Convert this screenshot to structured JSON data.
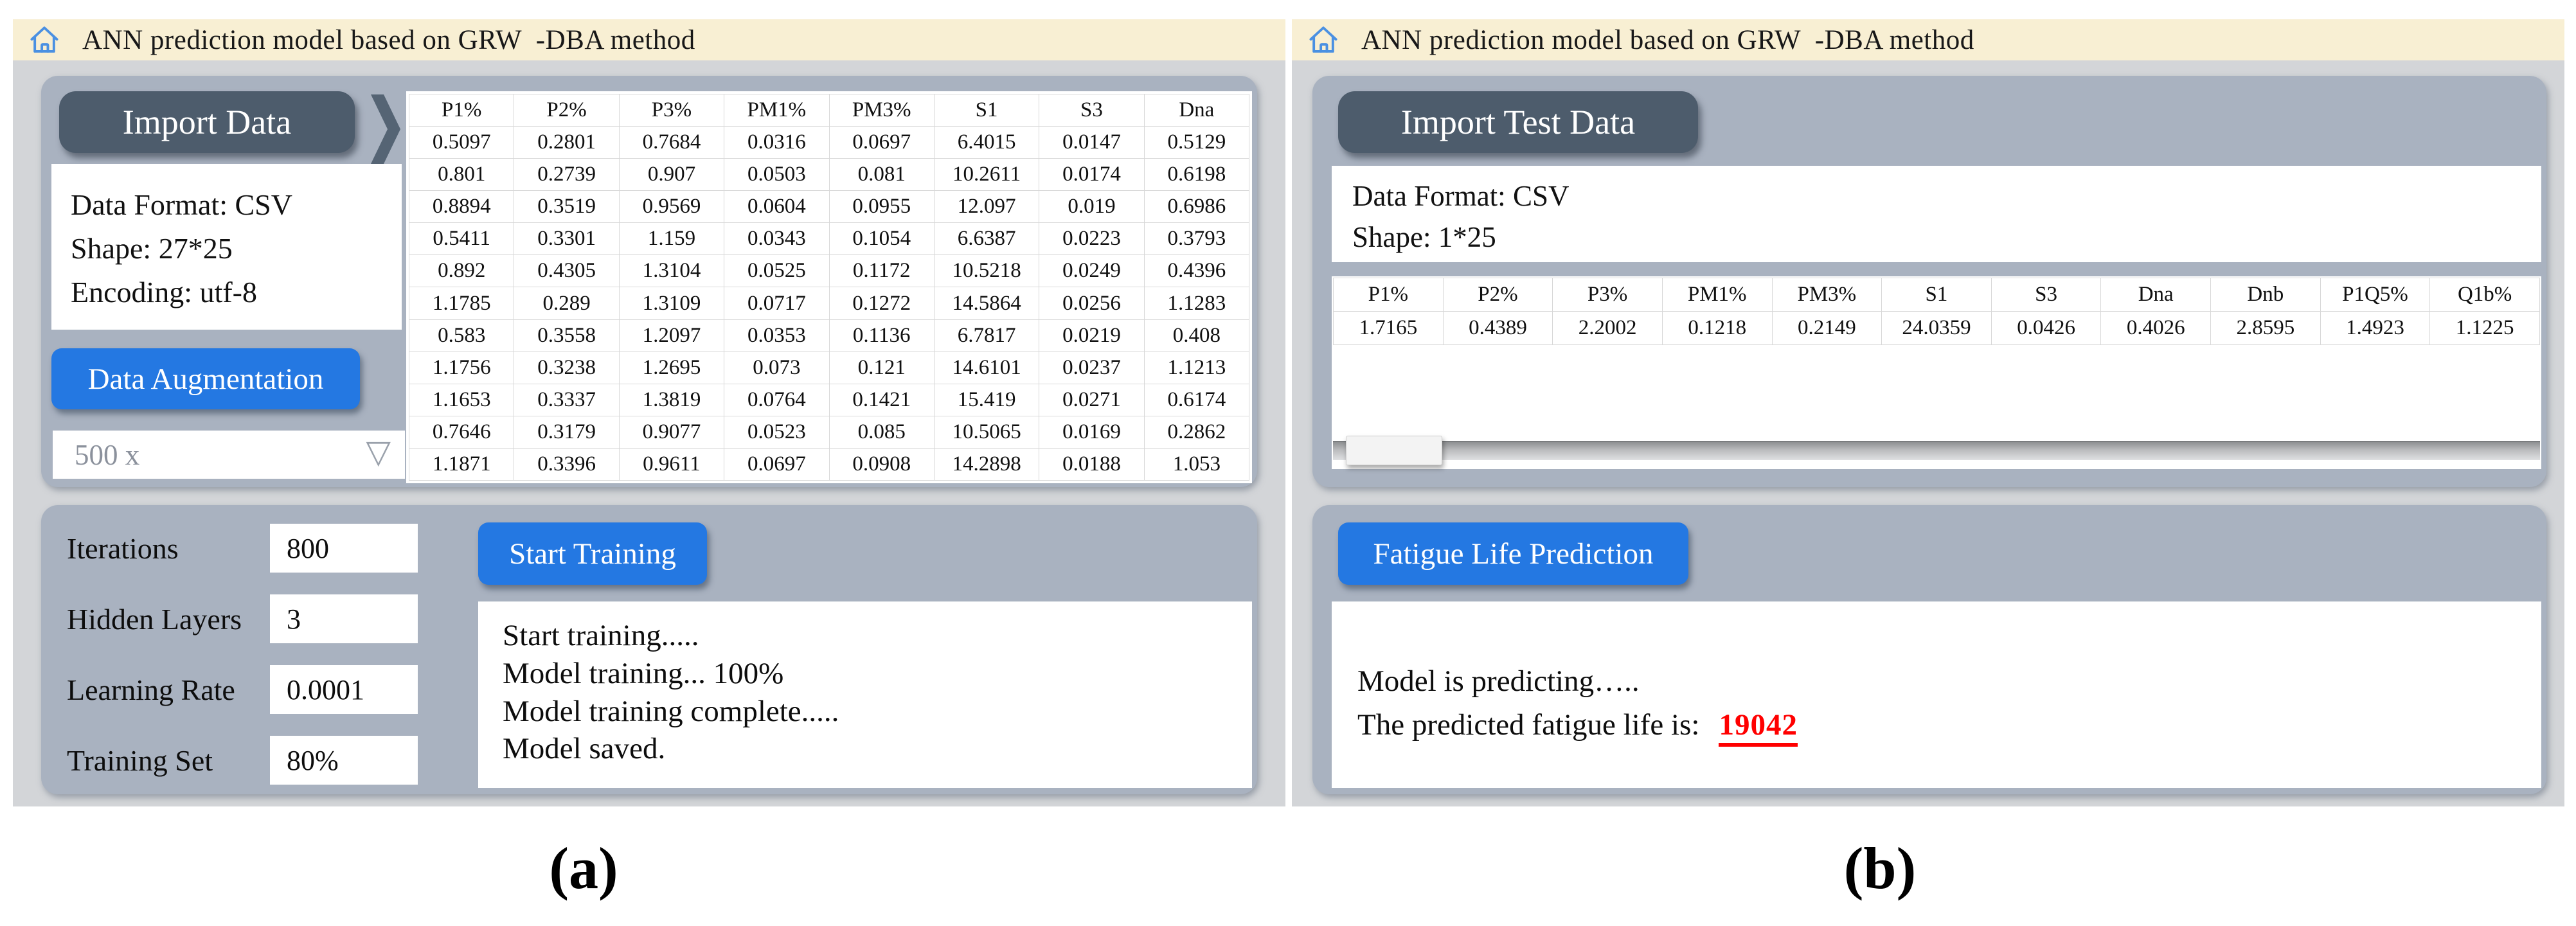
{
  "title": "ANN prediction model based on GRW  -DBA method",
  "colors": {
    "titlebar_bg": "#f8efd3",
    "home_icon_blue": "#4a90e2",
    "window_bg": "#d3d5d8",
    "panel_bg": "#a9b2c0",
    "slate_button": "#4d5c6c",
    "blue_button": "#2478e2",
    "prediction_red": "#ff0000"
  },
  "window_a": {
    "import_button_label": "Import Data",
    "info_lines": [
      "Data Format: CSV",
      "Shape: 27*25",
      "Encoding: utf-8"
    ],
    "augment_button_label": "Data Augmentation",
    "augment_multiplier": "500 x",
    "table": {
      "headers": [
        "P1%",
        "P2%",
        "P3%",
        "PM1%",
        "PM3%",
        "S1",
        "S3",
        "Dna"
      ],
      "rows": [
        [
          "0.5097",
          "0.2801",
          "0.7684",
          "0.0316",
          "0.0697",
          "6.4015",
          "0.0147",
          "0.5129"
        ],
        [
          "0.801",
          "0.2739",
          "0.907",
          "0.0503",
          "0.081",
          "10.2611",
          "0.0174",
          "0.6198"
        ],
        [
          "0.8894",
          "0.3519",
          "0.9569",
          "0.0604",
          "0.0955",
          "12.097",
          "0.019",
          "0.6986"
        ],
        [
          "0.5411",
          "0.3301",
          "1.159",
          "0.0343",
          "0.1054",
          "6.6387",
          "0.0223",
          "0.3793"
        ],
        [
          "0.892",
          "0.4305",
          "1.3104",
          "0.0525",
          "0.1172",
          "10.5218",
          "0.0249",
          "0.4396"
        ],
        [
          "1.1785",
          "0.289",
          "1.3109",
          "0.0717",
          "0.1272",
          "14.5864",
          "0.0256",
          "1.1283"
        ],
        [
          "0.583",
          "0.3558",
          "1.2097",
          "0.0353",
          "0.1136",
          "6.7817",
          "0.0219",
          "0.408"
        ],
        [
          "1.1756",
          "0.3238",
          "1.2695",
          "0.073",
          "0.121",
          "14.6101",
          "0.0237",
          "1.1213"
        ],
        [
          "1.1653",
          "0.3337",
          "1.3819",
          "0.0764",
          "0.1421",
          "15.419",
          "0.0271",
          "0.6174"
        ],
        [
          "0.7646",
          "0.3179",
          "0.9077",
          "0.0523",
          "0.085",
          "10.5065",
          "0.0169",
          "0.2862"
        ],
        [
          "1.1871",
          "0.3396",
          "0.9611",
          "0.0697",
          "0.0908",
          "14.2898",
          "0.0188",
          "1.053"
        ]
      ]
    },
    "params": [
      {
        "label": "Iterations",
        "value": "800"
      },
      {
        "label": "Hidden Layers",
        "value": "3"
      },
      {
        "label": "Learning Rate",
        "value": "0.0001"
      },
      {
        "label": "Training Set",
        "value": "80%"
      }
    ],
    "start_button_label": "Start Training",
    "log_lines": [
      "Start training.....",
      "Model training... 100%",
      "Model training complete.....",
      "Model saved."
    ],
    "caption": "(a)"
  },
  "window_b": {
    "import_button_label": "Import Test Data",
    "info_lines": [
      "Data Format: CSV",
      "Shape: 1*25"
    ],
    "table": {
      "headers": [
        "P1%",
        "P2%",
        "P3%",
        "PM1%",
        "PM3%",
        "S1",
        "S3",
        "Dna",
        "Dnb",
        "P1Q5%",
        "Q1b%"
      ],
      "rows": [
        [
          "1.7165",
          "0.4389",
          "2.2002",
          "0.1218",
          "0.2149",
          "24.0359",
          "0.0426",
          "0.4026",
          "2.8595",
          "1.4923",
          "1.1225"
        ]
      ]
    },
    "predict_button_label": "Fatigue Life Prediction",
    "predicting_line": "Model is predicting…..",
    "result_label": "The predicted fatigue life is:",
    "result_value": "19042",
    "caption": "(b)"
  }
}
